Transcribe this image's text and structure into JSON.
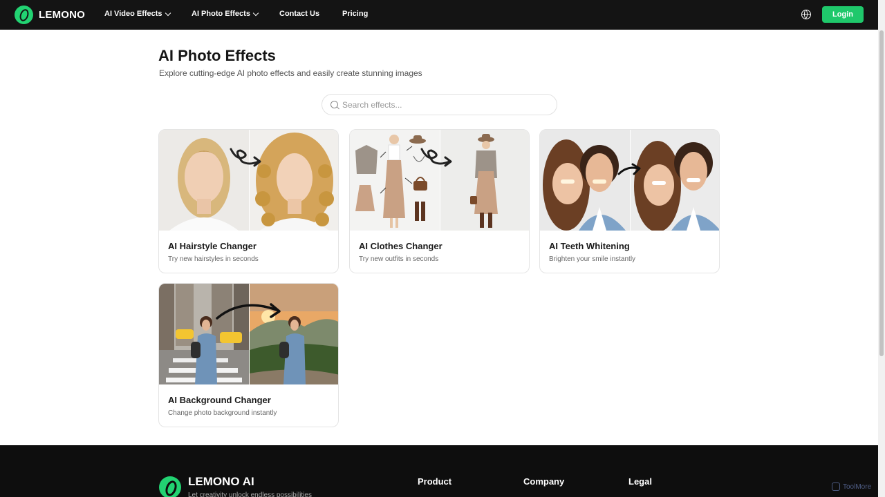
{
  "nav": {
    "logo_text": "LEMONO",
    "items": [
      {
        "label": "AI Video Effects",
        "has_dropdown": true
      },
      {
        "label": "AI Photo Effects",
        "has_dropdown": true
      },
      {
        "label": "Contact Us",
        "has_dropdown": false
      },
      {
        "label": "Pricing",
        "has_dropdown": false
      }
    ],
    "globe_icon": "globe-icon",
    "login_label": "Login"
  },
  "header": {
    "title": "AI Photo Effects",
    "subtitle": "Explore cutting-edge AI photo effects and easily create stunning images"
  },
  "search": {
    "placeholder": "Search effects...",
    "value": "",
    "icon": "search-icon"
  },
  "cards": [
    {
      "title": "AI Hairstyle Changer",
      "subtitle": "Try new hairstyles in seconds"
    },
    {
      "title": "AI Clothes Changer",
      "subtitle": "Try new outfits in seconds"
    },
    {
      "title": "AI Teeth Whitening",
      "subtitle": "Brighten your smile instantly"
    },
    {
      "title": "AI Background Changer",
      "subtitle": "Change photo background instantly"
    }
  ],
  "footer": {
    "brand": "LEMONO AI",
    "tagline": "Let creativity unlock endless possibilities",
    "columns": [
      "Product",
      "Company",
      "Legal"
    ]
  },
  "watermark": "ToolMore",
  "colors": {
    "accent": "#1fc86b",
    "nav_bg": "#141414",
    "footer_bg": "#0e0e0e"
  }
}
